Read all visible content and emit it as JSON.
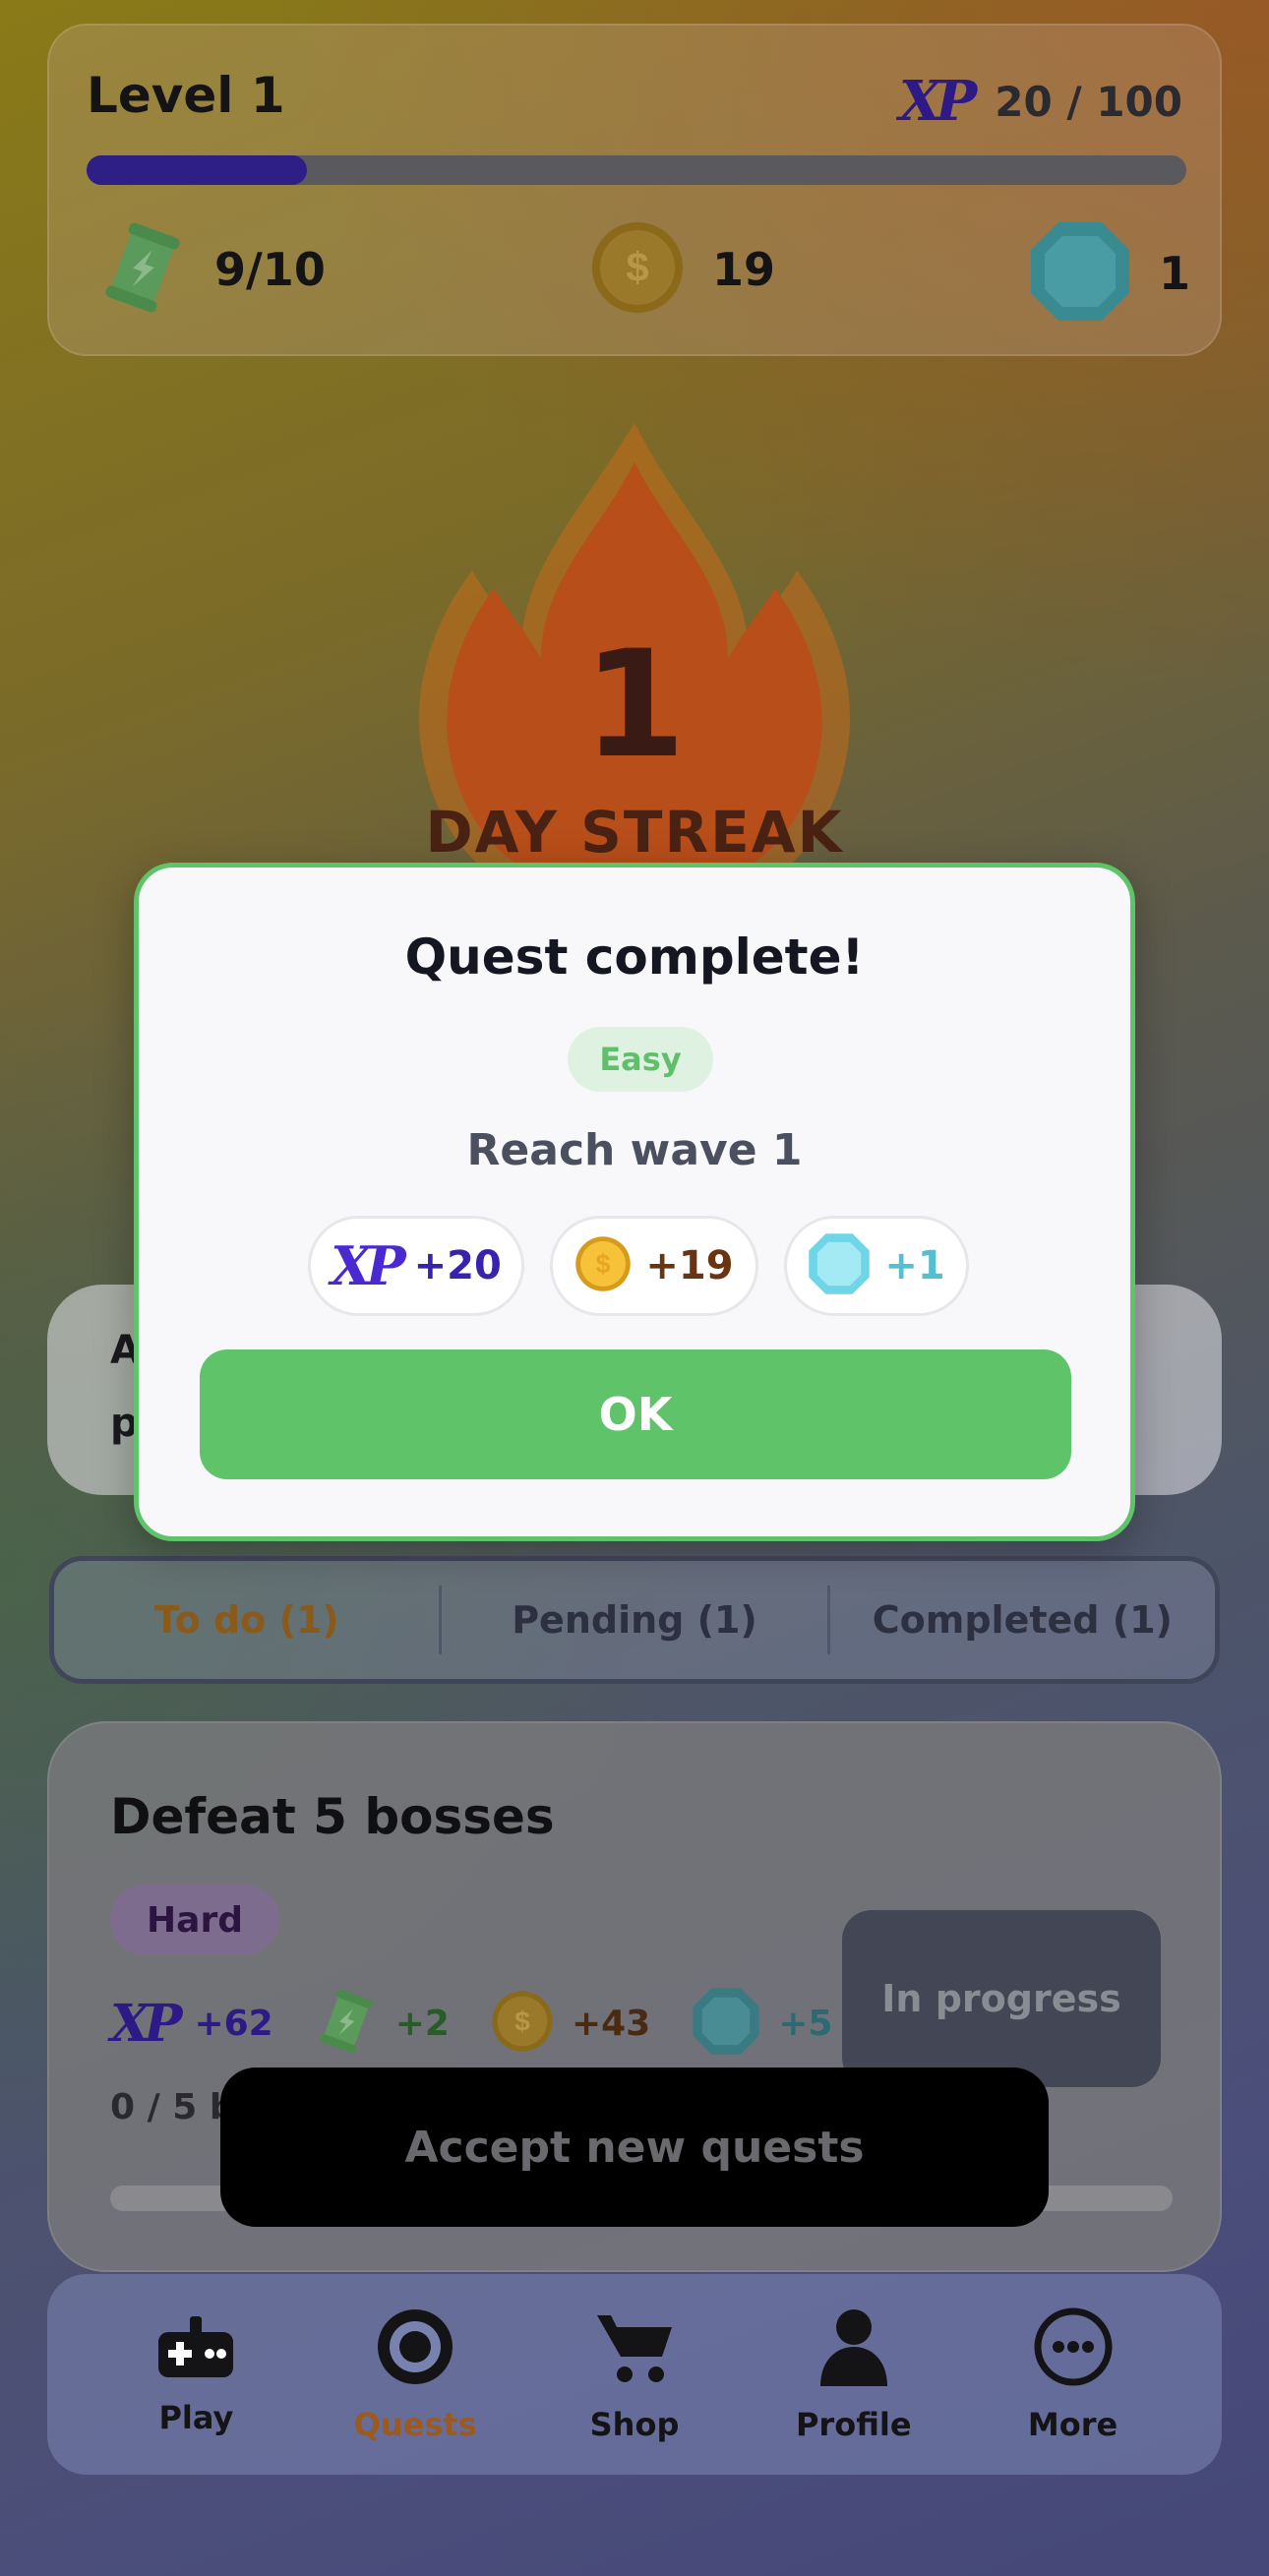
{
  "header": {
    "level_label": "Level 1",
    "xp_icon_text": "XP",
    "xp_value": "20 / 100",
    "xp_progress": 0.2,
    "energy_value": "9/10",
    "coins_value": "19",
    "gems_value": "1"
  },
  "streak": {
    "count": "1",
    "label": "DAY STREAK"
  },
  "info_card": {
    "line1": "A",
    "line2": "p"
  },
  "tabs": [
    {
      "label": "To do (1)"
    },
    {
      "label": "Pending (1)"
    },
    {
      "label": "Completed (1)"
    }
  ],
  "quest": {
    "title": "Defeat 5 bosses",
    "difficulty": "Hard",
    "xp_icon_text": "XP",
    "xp_reward": "+62",
    "energy_reward": "+2",
    "coin_reward": "+43",
    "gem_reward": "+5",
    "progress_text": "0 / 5 b",
    "status_button": "In progress"
  },
  "accept_button": "Accept new quests",
  "nav": [
    {
      "label": "Play",
      "icon": "gamepad-icon"
    },
    {
      "label": "Quests",
      "icon": "target-icon"
    },
    {
      "label": "Shop",
      "icon": "cart-icon"
    },
    {
      "label": "Profile",
      "icon": "person-icon"
    },
    {
      "label": "More",
      "icon": "more-icon"
    }
  ],
  "modal": {
    "title": "Quest complete!",
    "difficulty": "Easy",
    "quest_name": "Reach wave 1",
    "xp_icon_text": "XP",
    "xp_reward": "+20",
    "coin_reward": "+19",
    "gem_reward": "+1",
    "ok_label": "OK"
  },
  "colors": {
    "accent_green": "#5fc36a",
    "xp_purple": "#2d1f86",
    "active_tab": "#8a5a1a"
  }
}
